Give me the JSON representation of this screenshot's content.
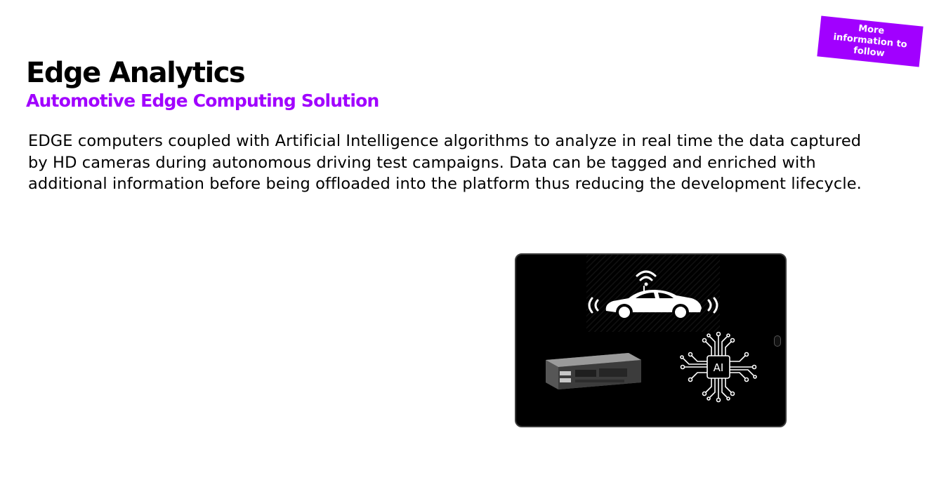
{
  "slide": {
    "title": "Edge Analytics",
    "subtitle": "Automotive Edge Computing Solution",
    "body": "EDGE computers coupled with Artificial Intelligence algorithms to analyze in real time the data captured by HD cameras during autonomous driving test campaigns. Data can be tagged and enriched with additional information before being offloaded into the platform thus reducing the development lifecycle.",
    "badge": "More information to follow",
    "accent_color": "#a100ff"
  },
  "illustration": {
    "icons": [
      "connected-car-icon",
      "edge-computer-icon",
      "ai-chip-icon"
    ],
    "chip_label": "AI"
  }
}
